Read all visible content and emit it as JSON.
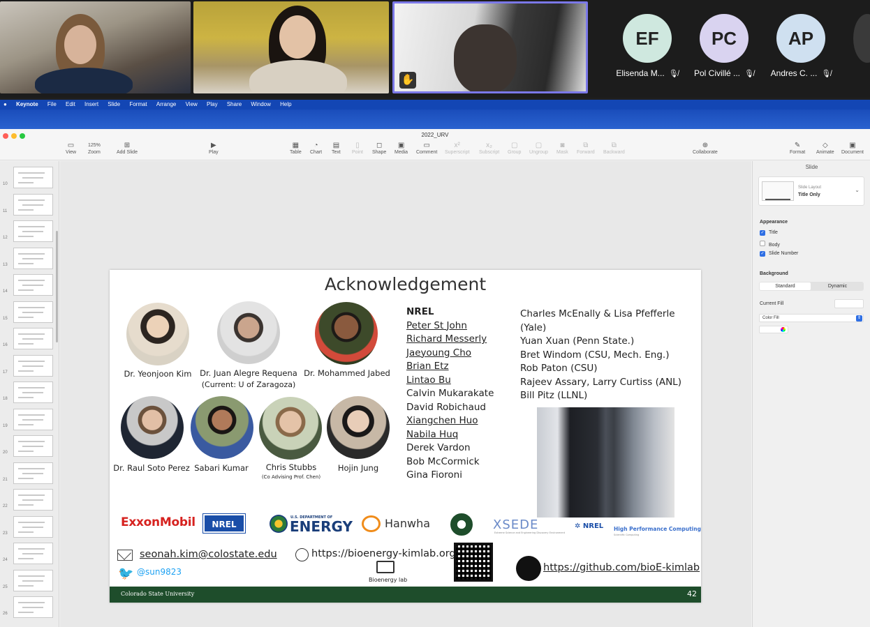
{
  "participants": {
    "avatars": [
      {
        "initials": "EF",
        "name": "Elisenda M...",
        "color": "#cfe8df"
      },
      {
        "initials": "PC",
        "name": "Pol Civillé ...",
        "color": "#d9d3f0"
      },
      {
        "initials": "AP",
        "name": "Andres C. ...",
        "color": "#cfe0f0"
      }
    ]
  },
  "menubar": {
    "app": "Keynote",
    "items": [
      "File",
      "Edit",
      "Insert",
      "Slide",
      "Format",
      "Arrange",
      "View",
      "Play",
      "Share",
      "Window",
      "Help"
    ]
  },
  "window": {
    "title": "2022_URV",
    "zoom_value": "125%",
    "toolbar": {
      "view": "View",
      "zoom": "Zoom",
      "add_slide": "Add Slide",
      "play": "Play",
      "table": "Table",
      "chart": "Chart",
      "text": "Text",
      "point": "Point",
      "shape": "Shape",
      "media": "Media",
      "comment": "Comment",
      "superscript": "Superscript",
      "subscript": "Subscript",
      "group": "Group",
      "ungroup": "Ungroup",
      "mask": "Mask",
      "forward": "Forward",
      "backward": "Backward",
      "collaborate": "Collaborate",
      "format": "Format",
      "animate": "Animate",
      "document": "Document"
    }
  },
  "navigator": {
    "slide_numbers": [
      "10",
      "11",
      "12",
      "13",
      "14",
      "15",
      "16",
      "17",
      "18",
      "19",
      "20",
      "21",
      "22",
      "23",
      "24",
      "25",
      "26"
    ]
  },
  "inspector": {
    "tab": "Slide",
    "layout_label": "Slide Layout",
    "layout_value": "Title Only",
    "appearance_header": "Appearance",
    "title_label": "Title",
    "body_label": "Body",
    "slide_number_label": "Slide Number",
    "background_header": "Background",
    "standard_label": "Standard",
    "dynamic_label": "Dynamic",
    "current_fill_label": "Current Fill",
    "color_fill_label": "Color Fill"
  },
  "slide": {
    "title": "Acknowledgement",
    "people": [
      {
        "name": "Dr. Yeonjoon Kim",
        "sub": ""
      },
      {
        "name": "Dr. Juan Alegre Requena",
        "sub": "(Current: U of Zaragoza)"
      },
      {
        "name": "Dr. Mohammed Jabed",
        "sub": ""
      },
      {
        "name": "Dr. Raul Soto Perez",
        "sub": ""
      },
      {
        "name": "Sabari Kumar",
        "sub": ""
      },
      {
        "name": "Chris Stubbs",
        "sub": "(Co Advising Prof. Chen)"
      },
      {
        "name": "Hojin Jung",
        "sub": ""
      }
    ],
    "nrel_header": "NREL",
    "nrel_members": [
      "Peter St John",
      "Richard Messerly",
      "Jaeyoung Cho",
      "Brian Etz",
      "Lintao Bu",
      "Calvin Mukarakate",
      "David Robichaud",
      "Xiangchen Huo",
      "Nabila Huq",
      "Derek Vardon",
      "Bob McCormick",
      "Gina Fioroni"
    ],
    "collaborators": [
      "Charles McEnally & Lisa Pfefferle (Yale)",
      "Yuan Xuan (Penn State.)",
      "Bret Windom (CSU, Mech. Eng.)",
      "Rob Paton (CSU)",
      "Rajeev Assary, Larry Curtiss (ANL)",
      "Bill Pitz (LLNL)"
    ],
    "logos": {
      "exxon": "ExxonMobil",
      "nrel": "NREL",
      "doe_small": "U.S. DEPARTMENT OF",
      "doe": "ENERGY",
      "hanwha": "Hanwha",
      "xsede": "XSEDE",
      "xsede_sub": "Extreme Science and Engineering Discovery Environment",
      "nrel_hpc": "NREL",
      "hpc": "High Performance Computing",
      "hpc_sub": "Scientific Computing"
    },
    "email": "seonah.kim@colostate.edu",
    "twitter": "@sun9823",
    "website": "https://bioenergy-kimlab.org",
    "lab_name": "Bioenergy lab",
    "github": "https://github.com/bioE-kimlab",
    "footer_university": "Colorado State University",
    "slide_number": "42"
  }
}
